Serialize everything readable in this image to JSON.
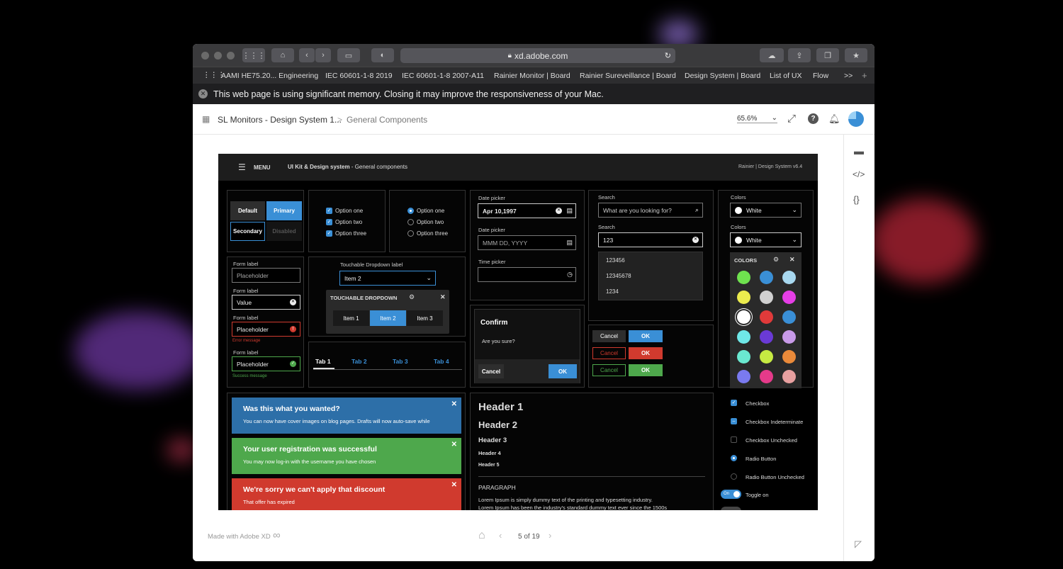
{
  "browser": {
    "url": "xd.adobe.com",
    "bookmarks": [
      "AAMI HE75.20... Engineering",
      "IEC 60601-1-8 2019",
      "IEC 60601-1-8 2007-A11",
      "Rainier Monitor | Board",
      "Rainier Sureveillance | Board",
      "Design System | Board",
      "List of UX",
      "Flow"
    ],
    "overflow": ">>",
    "new_tab": "+",
    "banner": "This web page is using significant memory. Closing it may improve the responsiveness of your Mac."
  },
  "xd": {
    "project": "SL Monitors - Design System 1...",
    "separator": ">",
    "page": "General Components",
    "zoom": "65.6%",
    "made_with": "Made with Adobe XD",
    "pager": "5 of 19"
  },
  "artboard": {
    "menu": "MENU",
    "title_bold": "UI Kit & Design system",
    "title_rest": " - General components",
    "version": "Rainier | Design System  v6.4",
    "buttons": {
      "default": "Default",
      "primary": "Primary",
      "secondary": "Secondary",
      "disabled": "Disabled"
    },
    "checks": [
      "Option one",
      "Option two",
      "Option three"
    ],
    "radios": [
      "Option one",
      "Option two",
      "Option three"
    ],
    "forms": [
      {
        "label": "Form label",
        "value": "Placeholder"
      },
      {
        "label": "Form label",
        "value": "Value"
      },
      {
        "label": "Form label",
        "value": "Placeholder",
        "msg": "Error message"
      },
      {
        "label": "Form label",
        "value": "Placeholder",
        "msg": "Success message"
      }
    ],
    "touchable": {
      "label": "Touchable Dropdown label",
      "value": "Item 2",
      "header": "TOUCHABLE DROPDOWN",
      "items": [
        "Item 1",
        "Item 2",
        "Item 3"
      ]
    },
    "tabs": [
      "Tab 1",
      "Tab 2",
      "Tab 3",
      "Tab 4"
    ],
    "date": {
      "label1": "Date picker",
      "value1": "Apr 10,1997",
      "label2": "Date picker",
      "value2": "MMM DD, YYYY",
      "label3": "Time picker",
      "value3": ""
    },
    "confirm": {
      "title": "Confirm",
      "body": "Are you sure?",
      "cancel": "Cancel",
      "ok": "OK"
    },
    "search": {
      "label1": "Search",
      "placeholder": "What are you looking for?",
      "label2": "Search",
      "value": "123",
      "results": [
        "123456",
        "12345678",
        "1234"
      ]
    },
    "pairs": [
      {
        "cancel": "Cancel",
        "ok": "OK"
      },
      {
        "cancel": "Cancel",
        "ok": "OK"
      },
      {
        "cancel": "Cancel",
        "ok": "OK"
      }
    ],
    "colors": {
      "label1": "Colors",
      "value1": "White",
      "label2": "Colors",
      "value2": "White",
      "header": "COLORS",
      "swatches": [
        "#6fe24f",
        "#3a8fd6",
        "#a8d8ef",
        "#ecec4e",
        "#d0d0d0",
        "#e63ee6",
        "#ffffff",
        "#e03a3a",
        "#3a8fd6",
        "#6fe8e8",
        "#6a3ad6",
        "#c89ae8",
        "#6ae8d0",
        "#c6ea42",
        "#ea8a3a",
        "#7a7af0",
        "#e63a8a",
        "#e8a0a0"
      ]
    },
    "alerts": [
      {
        "title": "Was this what you wanted?",
        "msg": "You can now have cover images on blog pages. Drafts will now auto-save while",
        "color": "#2d6fa8"
      },
      {
        "title": "Your user registration was successful",
        "msg": "You may now log-in with the username you have chosen",
        "color": "#4ea84c"
      },
      {
        "title": "We're sorry we can't apply that discount",
        "msg": "That offer has expired",
        "color": "#d03a2e"
      }
    ],
    "type": {
      "h1": "Header 1",
      "h2": "Header 2",
      "h3": "Header 3",
      "h4": "Header 4",
      "h5": "Header 5",
      "para": "PARAGRAPH",
      "lorem1": "Lorem Ipsum is simply dummy text of the printing and typesetting industry.",
      "lorem2": "Lorem Ipsum has been the industry's standard dummy text ever since the 1500s"
    },
    "controls": {
      "checkbox": "Checkbox",
      "indeterminate": "Checkbox Indeterminate",
      "unchecked": "Checkbox Unchecked",
      "radio": "Radio Button",
      "radio_unchecked": "Radio Button Unchecked",
      "toggle": "Toggle on",
      "toggle_state": "On"
    }
  }
}
